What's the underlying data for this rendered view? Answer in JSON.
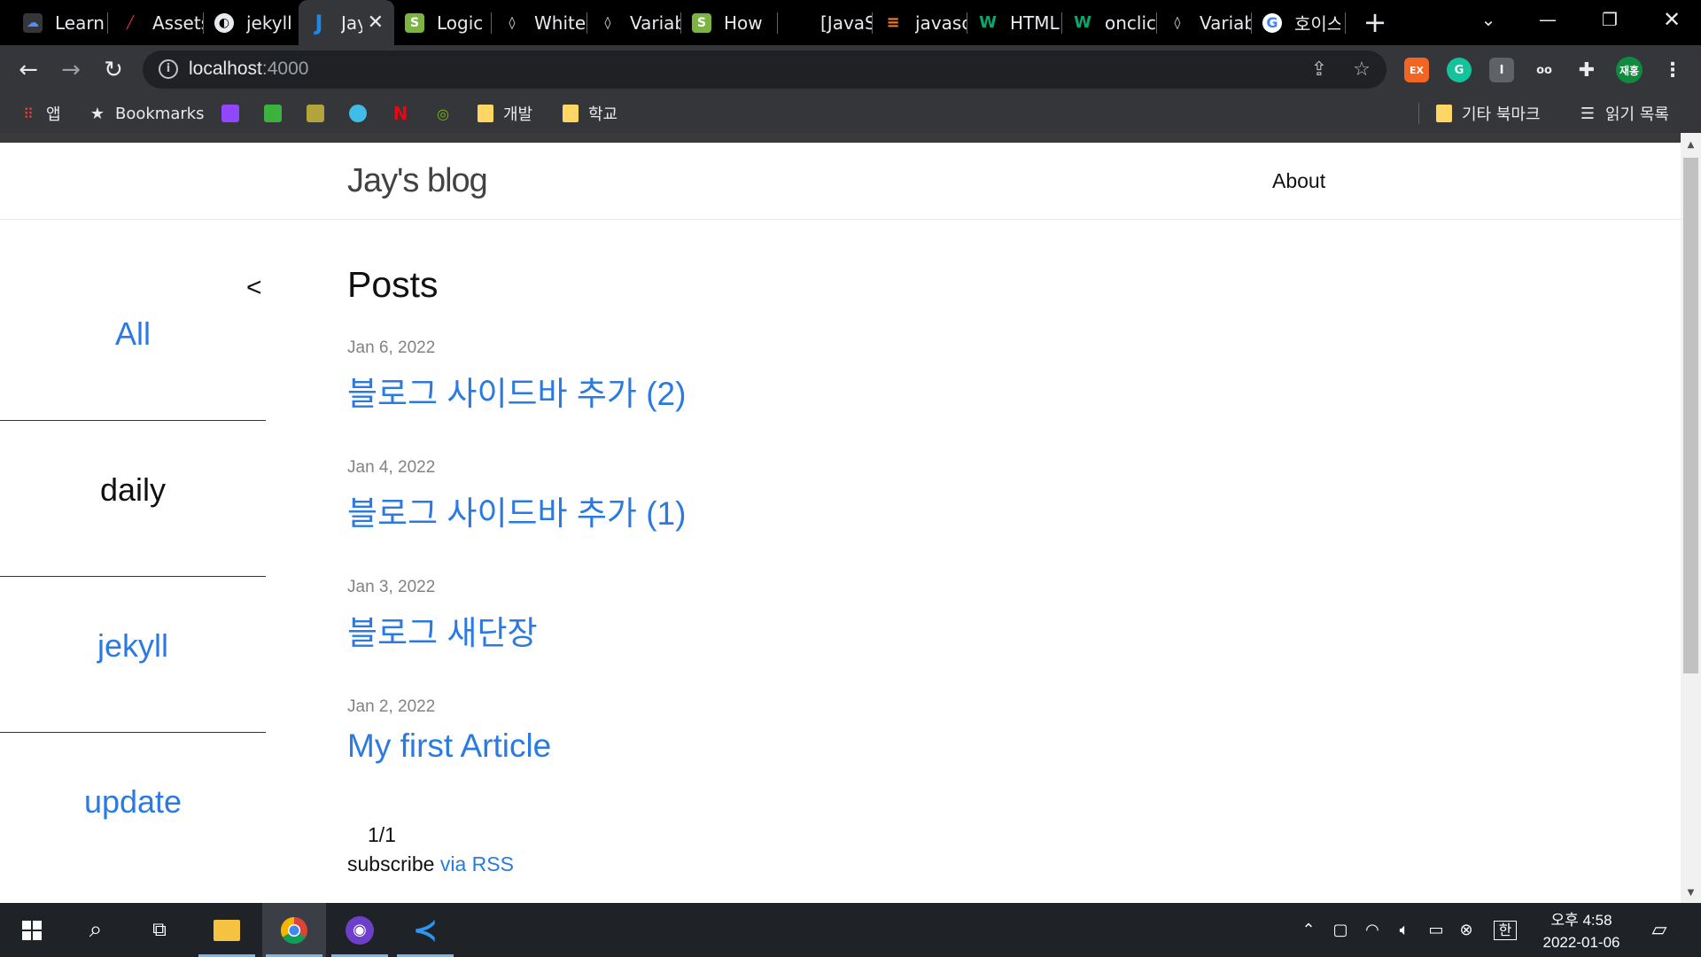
{
  "browser": {
    "tabs": [
      {
        "title": "Learn",
        "favicon": "learn-icon",
        "color": "#4f8ef7"
      },
      {
        "title": "Assets",
        "favicon": "pen-icon",
        "color": "#e53935"
      },
      {
        "title": "jekyll",
        "favicon": "globe-icon",
        "color": "#e8eaed"
      },
      {
        "title": "Jay",
        "favicon": "j-icon",
        "color": "#1e88e5",
        "active": true
      },
      {
        "title": "Logic",
        "favicon": "shopify-icon",
        "color": "#7cb342"
      },
      {
        "title": "White",
        "favicon": "drop-icon",
        "color": "#e8eaed"
      },
      {
        "title": "Variab",
        "favicon": "drop-icon",
        "color": "#e8eaed"
      },
      {
        "title": "How t",
        "favicon": "shopify-icon",
        "color": "#7cb342"
      },
      {
        "title": "[JavaS",
        "favicon": "blank-icon",
        "color": "#000000"
      },
      {
        "title": "javasc",
        "favicon": "stack-icon",
        "color": "#f48024"
      },
      {
        "title": "HTML",
        "favicon": "w3-icon",
        "color": "#04aa6d"
      },
      {
        "title": "onclic",
        "favicon": "w3-icon",
        "color": "#04aa6d"
      },
      {
        "title": "Variab",
        "favicon": "drop-icon",
        "color": "#e8eaed"
      },
      {
        "title": "호이스",
        "favicon": "google-icon",
        "color": "#ffffff"
      }
    ],
    "url_host": "localhost",
    "url_port": ":4000",
    "profile_label": "재홍",
    "extensions": [
      {
        "label": "EX",
        "icon": "ex-icon",
        "color": "#f26522"
      },
      {
        "label": "G",
        "icon": "grammarly-icon",
        "color": "#15c39a"
      },
      {
        "label": "I",
        "icon": "info-ext-icon",
        "color": "#5f6368"
      },
      {
        "label": "oo",
        "icon": "glasses-icon",
        "color": "#35363a"
      }
    ],
    "bookmarks": {
      "apps": "앱",
      "bookmarks": "Bookmarks",
      "folder_dev": "개발",
      "folder_school": "학교",
      "other_bookmarks": "기타 북마크",
      "reading_list": "읽기 목록"
    }
  },
  "site": {
    "title": "Jay's blog",
    "nav_about": "About",
    "sidebar_toggle": "<",
    "categories": [
      "All",
      "daily",
      "jekyll",
      "update"
    ],
    "posts_heading": "Posts",
    "posts": [
      {
        "date": "Jan 6, 2022",
        "title": "블로그 사이드바 추가 (2)"
      },
      {
        "date": "Jan 4, 2022",
        "title": "블로그 사이드바 추가 (1)"
      },
      {
        "date": "Jan 3, 2022",
        "title": "블로그 새단장"
      },
      {
        "date": "Jan 2, 2022",
        "title": "My first Article"
      }
    ],
    "pagination": "1/1",
    "subscribe_text": "subscribe",
    "subscribe_link": "via RSS",
    "link_color": "#2a7ae2"
  },
  "taskbar": {
    "clock_time": "오후 4:58",
    "clock_date": "2022-01-06",
    "ime_label": "한"
  }
}
